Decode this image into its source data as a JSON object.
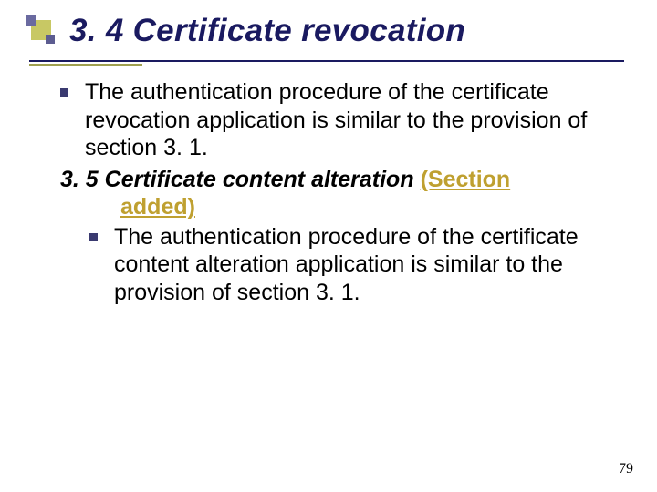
{
  "title": "3. 4 Certificate revocation",
  "bullets": {
    "b1": "The authentication procedure of the certificate revocation application is similar to the provision of section 3. 1.",
    "heading35_main": "3. 5 Certificate content alteration",
    "heading35_annot1": "(Section",
    "heading35_annot2": "added)",
    "b2": "The authentication procedure of the certificate content alteration application is similar to the provision of section 3. 1."
  },
  "page_number": "79"
}
